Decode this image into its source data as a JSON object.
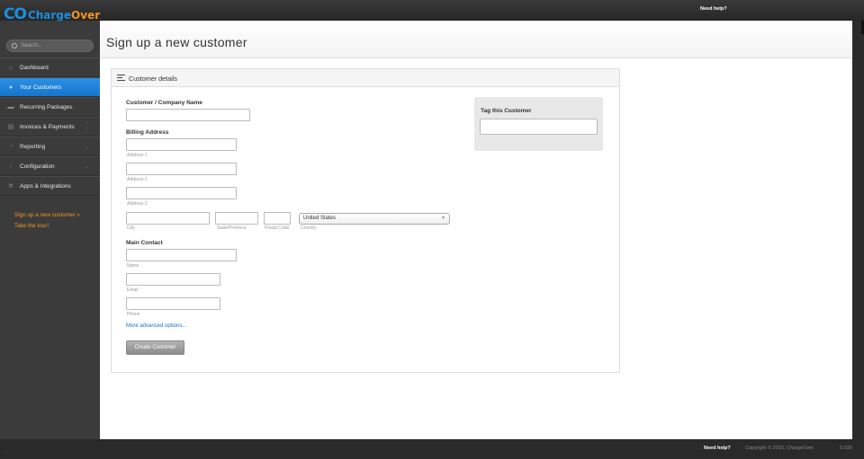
{
  "header": {
    "logo_co": "CO",
    "logo_charge": "Charge",
    "logo_over": "Over",
    "need_help": "Need help?"
  },
  "sidebar": {
    "search_placeholder": "Search...",
    "items": [
      {
        "label": "Dashboard",
        "icon": "home-icon"
      },
      {
        "label": "Your Customers",
        "icon": "user-icon"
      },
      {
        "label": "Recurring Packages",
        "icon": "package-icon"
      },
      {
        "label": "Invoices & Payments",
        "icon": "invoice-icon"
      },
      {
        "label": "Reporting",
        "icon": "reporting-icon"
      },
      {
        "label": "Configuration",
        "icon": "configuration-icon"
      },
      {
        "label": "Apps & Integrations",
        "icon": "apps-icon"
      }
    ],
    "links": [
      "Sign up a new customer »",
      "Take the tour!"
    ]
  },
  "page": {
    "title": "Sign up a new customer"
  },
  "form": {
    "panel_title": "Customer details",
    "company_label": "Customer / Company Name",
    "billing_label": "Billing Address",
    "address1_help": "Address 1",
    "address2_help": "Address 2",
    "address3_help": "Address 3",
    "city_help": "City",
    "state_help": "State/Province",
    "postal_help": "Postal Code",
    "country_help": "Country",
    "country_value": "United States",
    "contact_label": "Main Contact",
    "name_help": "Name",
    "email_help": "Email",
    "phone_help": "Phone",
    "advanced_link": "More advanced options...",
    "submit_label": "Create Customer",
    "tag_label": "Tag this Customer"
  },
  "footer": {
    "dot": ".",
    "need_help": "Need help?",
    "copyright": "Copyright © 2015, ChargeOver.",
    "version": "0.039"
  }
}
